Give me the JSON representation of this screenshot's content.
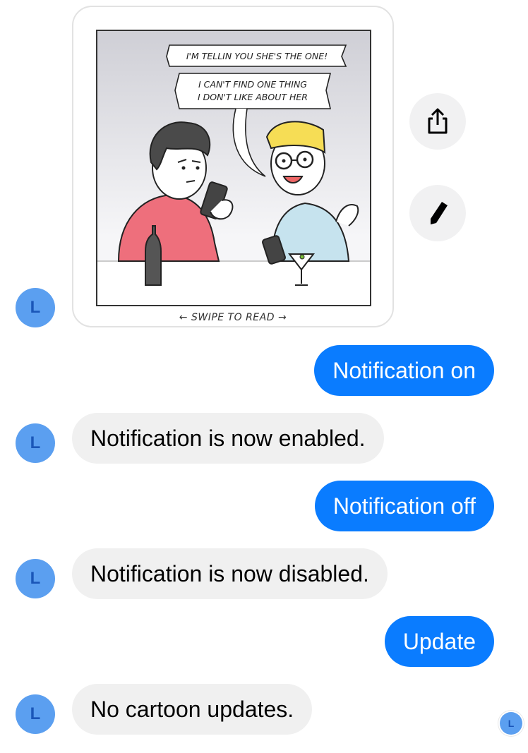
{
  "avatar_initial": "L",
  "comic": {
    "speech_line_1": "I'M TELLIN YOU SHE'S THE ONE!",
    "speech_line_2a": "I CAN'T FIND ONE THING",
    "speech_line_2b": "I DON'T LIKE ABOUT HER",
    "swipe_label": "← SWIPE TO READ →"
  },
  "actions": {
    "share_icon": "share-icon",
    "edit_icon": "pencil-icon"
  },
  "messages": [
    {
      "direction": "out",
      "text": "Notification on"
    },
    {
      "direction": "in",
      "text": "Notification is now enabled."
    },
    {
      "direction": "out",
      "text": "Notification off"
    },
    {
      "direction": "in",
      "text": "Notification is now disabled."
    },
    {
      "direction": "out",
      "text": "Update"
    },
    {
      "direction": "in",
      "text": "No cartoon updates."
    }
  ],
  "colors": {
    "outgoing_bubble": "#0a7cff",
    "incoming_bubble": "#f0f0f0",
    "avatar": "#5b9ff0"
  }
}
